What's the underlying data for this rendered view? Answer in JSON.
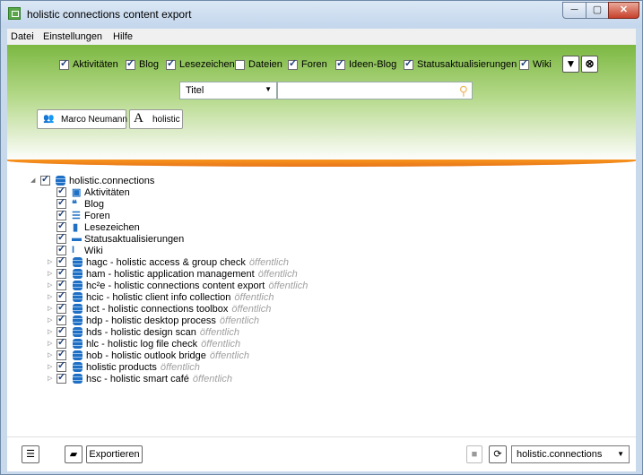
{
  "window": {
    "title": "holistic connections content export",
    "controls": {
      "minimize": "─",
      "maximize": "▢",
      "close": "✕"
    }
  },
  "menu": [
    "Datei",
    "Einstellungen",
    "Hilfe"
  ],
  "filters": [
    {
      "label": "Aktivitäten",
      "checked": true
    },
    {
      "label": "Blog",
      "checked": true
    },
    {
      "label": "Lesezeichen",
      "checked": true
    },
    {
      "label": "Dateien",
      "checked": false
    },
    {
      "label": "Foren",
      "checked": true
    },
    {
      "label": "Ideen-Blog",
      "checked": true
    },
    {
      "label": "Statusaktualisierungen",
      "checked": true
    },
    {
      "label": "Wiki",
      "checked": true
    }
  ],
  "search": {
    "field": "Titel",
    "value": "",
    "placeholder": ""
  },
  "chips": {
    "user": "Marco Neumann",
    "term": "holistic"
  },
  "tree": {
    "root": {
      "label": "holistic.connections",
      "checked": true
    },
    "categories": [
      {
        "label": "Aktivitäten",
        "icon": "activities-icon"
      },
      {
        "label": "Blog",
        "icon": "blog-icon"
      },
      {
        "label": "Foren",
        "icon": "forums-icon"
      },
      {
        "label": "Lesezeichen",
        "icon": "bookmarks-icon"
      },
      {
        "label": "Statusaktualisierungen",
        "icon": "status-icon"
      },
      {
        "label": "Wiki",
        "icon": "wiki-icon"
      }
    ],
    "communities": [
      {
        "label": "hagc - holistic access & group check",
        "visibility": "öffentlich"
      },
      {
        "label": "ham - holistic application management",
        "visibility": "öffentlich"
      },
      {
        "label": "hc²e - holistic connections content export",
        "visibility": "öffentlich"
      },
      {
        "label": "hcic - holistic client info collection",
        "visibility": "öffentlich"
      },
      {
        "label": "hct - holistic connections toolbox",
        "visibility": "öffentlich"
      },
      {
        "label": "hdp - holistic desktop process",
        "visibility": "öffentlich"
      },
      {
        "label": "hds - holistic design scan",
        "visibility": "öffentlich"
      },
      {
        "label": "hlc - holistic log file check",
        "visibility": "öffentlich"
      },
      {
        "label": "hob - holistic outlook bridge",
        "visibility": "öffentlich"
      },
      {
        "label": "holistic products",
        "visibility": "öffentlich"
      },
      {
        "label": "hsc - holistic smart café",
        "visibility": "öffentlich"
      }
    ]
  },
  "footer": {
    "export_label": "Exportieren",
    "server": "holistic.connections"
  },
  "colors": {
    "banner": "#7cb842",
    "accent": "#f7941e",
    "icon": "#1f6fc4"
  }
}
